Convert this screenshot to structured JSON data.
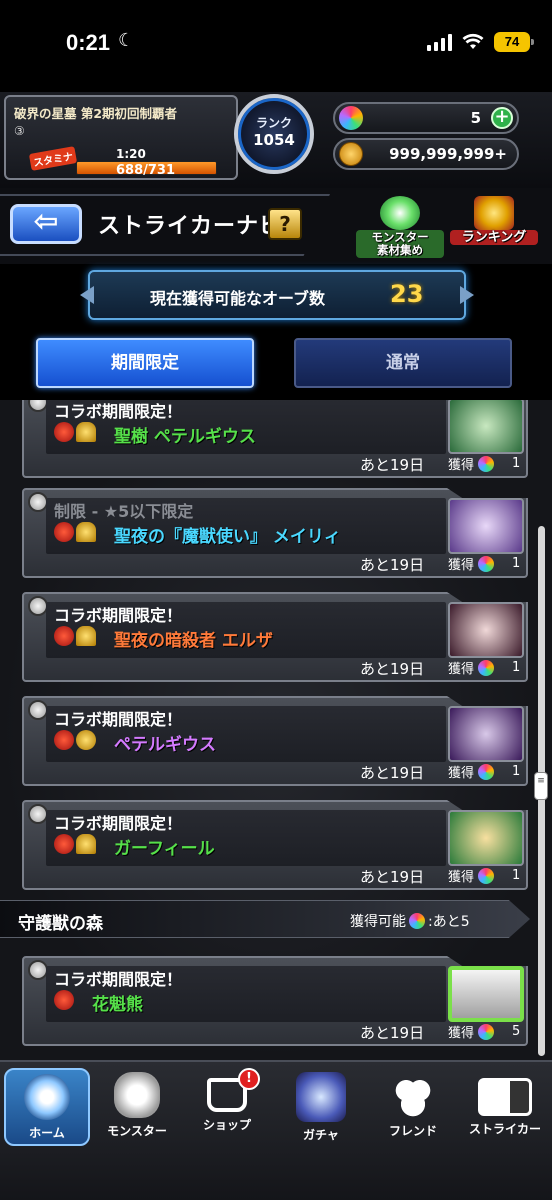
{
  "status_bar": {
    "time": "0:21",
    "battery": "74"
  },
  "player": {
    "title": "破界の星墓 第2期初回制覇者",
    "number": "③",
    "stamina_label": "スタミナ",
    "stamina_timer": "1:20",
    "stamina": "688/731",
    "stamina_fill_fraction": 0.94,
    "rank_label": "ランク",
    "rank": "1054"
  },
  "currency": {
    "orbs": "5",
    "gold": "999,999,999+"
  },
  "nav": {
    "title": "ストライカーナビ",
    "help_label": "?",
    "shortcut_collect": "モンスター\n素材集め",
    "shortcut_ranking": "ランキング"
  },
  "orb_counter": {
    "label": "現在獲得可能なオーブ数",
    "value": "23"
  },
  "tabs": {
    "limited": "期間限定",
    "normal": "通常"
  },
  "quests": [
    {
      "category": "コラボ期間限定！",
      "monster": "聖樹 ペテルギウス",
      "remaining": "あと19日",
      "reward_label": "獲得",
      "reward_count": "1",
      "color": "green"
    },
    {
      "category": "制限 - ★5以下限定",
      "monster": "聖夜の『魔獣使い』 メイリィ",
      "remaining": "あと19日",
      "reward_label": "獲得",
      "reward_count": "1",
      "color": "blue"
    },
    {
      "category": "コラボ期間限定！",
      "monster": "聖夜の暗殺者 エルザ",
      "remaining": "あと19日",
      "reward_label": "獲得",
      "reward_count": "1",
      "color": "red"
    },
    {
      "category": "コラボ期間限定！",
      "monster": "ペテルギウス",
      "remaining": "あと19日",
      "reward_label": "獲得",
      "reward_count": "1",
      "color": "purple"
    },
    {
      "category": "コラボ期間限定！",
      "monster": "ガーフィール",
      "remaining": "あと19日",
      "reward_label": "獲得",
      "reward_count": "1",
      "color": "green"
    }
  ],
  "section": {
    "title": "守護獣の森",
    "avail_label": "獲得可能",
    "avail_value": ":あと5"
  },
  "section_quest": {
    "category": "コラボ期間限定！",
    "monster": "花魁熊",
    "remaining": "あと19日",
    "reward_label": "獲得",
    "reward_count": "5"
  },
  "tabbar": {
    "home": "ホーム",
    "monster": "モンスター",
    "shop": "ショップ",
    "shop_badge": "!",
    "gacha": "ガチャ",
    "friend": "フレンド",
    "striker": "ストライカー"
  }
}
